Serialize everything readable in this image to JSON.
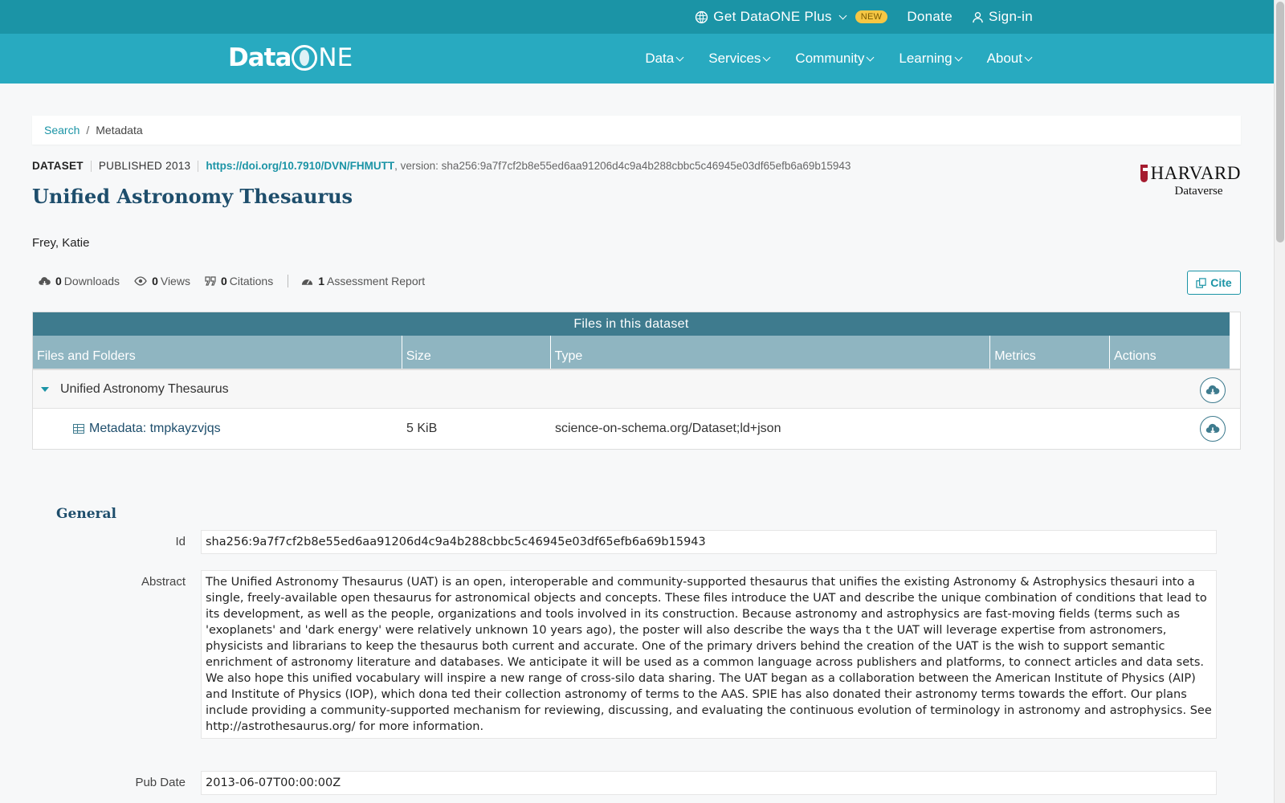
{
  "topbar": {
    "plus_label": "Get DataONE Plus",
    "new_badge": "NEW",
    "donate_label": "Donate",
    "signin_label": "Sign-in"
  },
  "navbar": {
    "logo_text_data": "Data",
    "logo_text_ne": "NE",
    "items": [
      {
        "label": "Data"
      },
      {
        "label": "Services"
      },
      {
        "label": "Community"
      },
      {
        "label": "Learning"
      },
      {
        "label": "About"
      }
    ]
  },
  "breadcrumb": {
    "search": "Search",
    "separator": "/",
    "current": "Metadata"
  },
  "dataset": {
    "kind": "DATASET",
    "published": "PUBLISHED 2013",
    "doi": "https://doi.org/10.7910/DVN/FHMUTT",
    "version": ", version: sha256:9a7f7cf2b8e55ed6aa91206d4c9a4b288cbbc5c46945e03df65efb6a69b15943",
    "title": "Unified Astronomy Thesaurus",
    "author": "Frey, Katie",
    "repository": {
      "name": "HARVARD",
      "sub": "Dataverse"
    }
  },
  "metrics": {
    "downloads_count": "0",
    "downloads_label": "Downloads",
    "views_count": "0",
    "views_label": "Views",
    "citations_count": "0",
    "citations_label": "Citations",
    "assessment_count": "1",
    "assessment_label": "Assessment Report",
    "cite_label": "Cite"
  },
  "files": {
    "title": "Files in this dataset",
    "columns": [
      "Files and Folders",
      "Size",
      "Type",
      "Metrics",
      "Actions"
    ],
    "package": {
      "name": "Unified Astronomy Thesaurus"
    },
    "rows": [
      {
        "name": "Metadata: tmpkayzvjqs",
        "size": "5 KiB",
        "type": "science-on-schema.org/Dataset;ld+json"
      }
    ]
  },
  "general": {
    "title": "General",
    "id_label": "Id",
    "id_value": "sha256:9a7f7cf2b8e55ed6aa91206d4c9a4b288cbbc5c46945e03df65efb6a69b15943",
    "abstract_label": "Abstract",
    "abstract_value": "The Unified Astronomy Thesaurus (UAT) is an open, interoperable and community-supported thesaurus that unifies the existing Astronomy & Astrophysics thesauri into a single, freely-available open thesaurus for astronomical objects and concepts. These files introduce the UAT and describe the unique combination of conditions that lead to its development, as well as the people, organizations and tools involved in its construction. Because astronomy and astrophysics are fast-moving fields (terms such as 'exoplanets' and 'dark energy' were relatively unknown 10 years ago), the poster will also describe the ways tha t the UAT will leverage expertise from astronomers, physicists and librarians to keep the thesaurus both current and accurate. One of the primary drivers behind the creation of the UAT is the wish to support semantic enrichment of astronomy literature and databases. We anticipate it will be used as a common language across publishers and platforms, to connect articles and data sets. We also hope this unified vocabulary will inspire a new range of cross-silo data sharing. The UAT began as a collaboration between the American Institute of Physics (AIP) and Institute of Physics (IOP), which dona ted their collection astronomy of terms to the AAS. SPIE has also donated their astronomy terms towards the effort. Our plans include providing a community-supported mechanism for reviewing, discussing, and evaluating the continuous evolution of terminology in astronomy and astrophysics. See http://astrothesaurus.org/ for more information.",
    "pubdate_label": "Pub Date",
    "pubdate_value": "2013-06-07T00:00:00Z"
  },
  "colors": {
    "topbar": "#1b94a6",
    "navbar": "#28aac0",
    "accent": "#1b94a6",
    "title": "#1e4e6c",
    "table_header": "#3e7b8e"
  }
}
